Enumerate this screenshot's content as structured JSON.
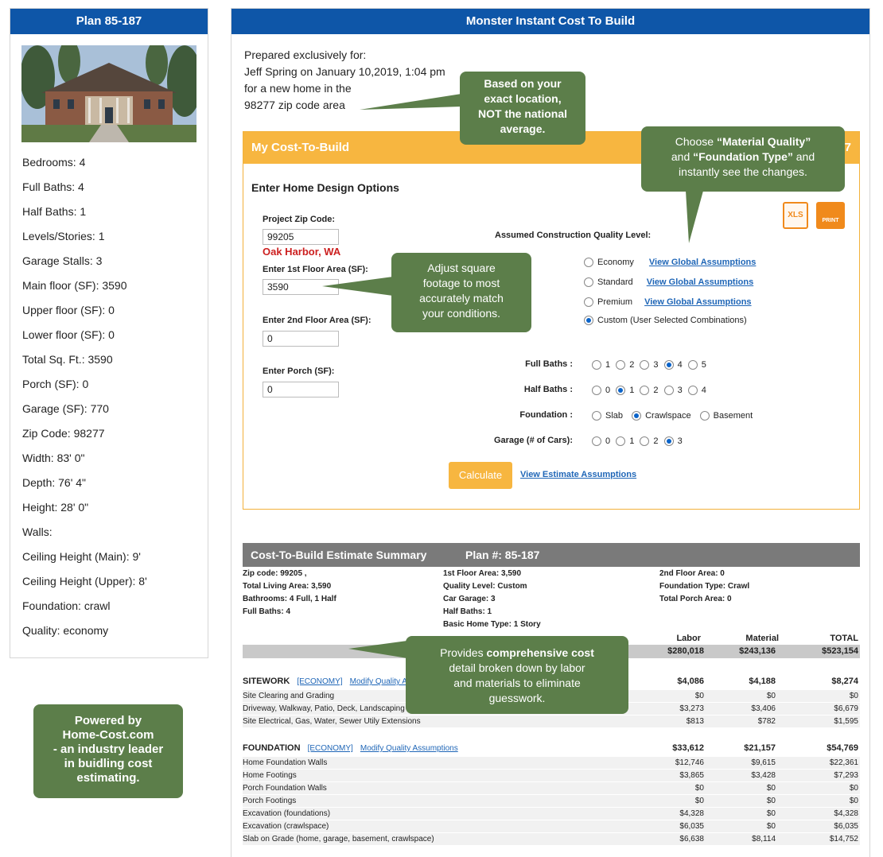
{
  "sidebar": {
    "title": "Plan 85-187",
    "specs": [
      "Bedrooms: 4",
      "Full Baths: 4",
      "Half Baths: 1",
      "Levels/Stories: 1",
      "Garage Stalls: 3",
      "Main floor (SF): 3590",
      "Upper floor (SF): 0",
      "Lower floor (SF): 0",
      "Total Sq. Ft.: 3590",
      "Porch (SF): 0",
      "Garage (SF): 770",
      "Zip Code: 98277",
      "Width: 83' 0\"",
      "Depth: 76' 4\"",
      "Height: 28' 0\"",
      "Walls:",
      "Ceiling Height (Main): 9'",
      "Ceiling Height (Upper): 8'",
      "Foundation: crawl",
      "Quality: economy"
    ]
  },
  "powered": [
    "Powered by",
    "Home-Cost.com",
    "- an industry leader",
    "in buidling cost",
    "estimating."
  ],
  "main": {
    "title": "Monster Instant Cost To Build",
    "prepared": [
      "Prepared exclusively for:",
      "Jeff Spring on January 10,2019, 1:04 pm",
      "for a new home in the",
      "98277 zip code area"
    ]
  },
  "callouts": {
    "location": [
      "Based on your",
      "exact location,",
      "NOT the national",
      "average."
    ],
    "material_pre": "Choose ",
    "material_b1": "“Material Quality”",
    "material_mid": "and ",
    "material_b2": "“Foundation Type”",
    "material_post": " and",
    "material_last": "instantly see the changes.",
    "sqft": [
      "Adjust square",
      "footage to most",
      "accurately match",
      "your conditions."
    ],
    "detail_pre": "Provides ",
    "detail_b": "comprehensive cost",
    "detail_rest": [
      "detail broken down by labor",
      "and materials to eliminate",
      "guesswork."
    ]
  },
  "mcb": {
    "title": "My Cost-To-Build",
    "plan_suffix": "187",
    "section_title": "Enter Home Design Options",
    "zip_label": "Project Zip Code:",
    "zip_value": "99205",
    "city": "Oak Harbor, WA",
    "floor1_label": "Enter 1st Floor Area (SF):",
    "floor1_value": "3590",
    "floor2_label": "Enter 2nd Floor Area (SF):",
    "floor2_value": "0",
    "porch_label": "Enter Porch (SF):",
    "porch_value": "0",
    "quality_label": "Assumed Construction Quality Level:",
    "quality_options": [
      {
        "label": "Economy",
        "link": "View Global Assumptions"
      },
      {
        "label": "Standard",
        "link": "View Global Assumptions"
      },
      {
        "label": "Premium",
        "link": "View Global Assumptions"
      },
      {
        "label": "Custom (User Selected Combinations)",
        "link": ""
      }
    ],
    "full_baths_label": "Full Baths :",
    "full_baths_opts": [
      "1",
      "2",
      "3",
      "4",
      "5"
    ],
    "half_baths_label": "Half Baths :",
    "half_baths_opts": [
      "0",
      "1",
      "2",
      "3",
      "4"
    ],
    "foundation_label": "Foundation :",
    "foundation_opts": [
      "Slab",
      "Crawlspace",
      "Basement"
    ],
    "garage_label": "Garage (# of Cars):",
    "garage_opts": [
      "0",
      "1",
      "2",
      "3"
    ],
    "calculate": "Calculate",
    "view_assumptions": "View Estimate Assumptions",
    "xls": "XLS",
    "print": "PRINT"
  },
  "summary": {
    "title": "Cost-To-Build Estimate Summary",
    "plan": "Plan #: 85-187",
    "col1": [
      "Zip code: 99205 ,",
      "Total Living Area: 3,590",
      "Bathrooms: 4 Full, 1 Half",
      "Full Baths: 4"
    ],
    "col2": [
      "1st Floor Area: 3,590",
      "Quality Level: Custom",
      "Car Garage: 3",
      "Half Baths: 1",
      "Basic Home Type: 1 Story"
    ],
    "col3": [
      "2nd Floor Area: 0",
      "Foundation Type: Crawl",
      "Total Porch Area: 0"
    ],
    "headers": [
      "Labor",
      "Material",
      "TOTAL"
    ],
    "totals": [
      "$280,018",
      "$243,136",
      "$523,154"
    ]
  },
  "sections": [
    {
      "name": "SITEWORK",
      "tag": "[ECONOMY]",
      "link": "Modify Quality Assu",
      "values": [
        "$4,086",
        "$4,188",
        "$8,274"
      ],
      "items": [
        {
          "label": "Site Clearing and Grading",
          "values": [
            "$0",
            "$0",
            "$0"
          ]
        },
        {
          "label": "Driveway, Walkway, Patio, Deck, Landscaping",
          "values": [
            "$3,273",
            "$3,406",
            "$6,679"
          ]
        },
        {
          "label": "Site Electrical, Gas, Water, Sewer Utily Extensions",
          "values": [
            "$813",
            "$782",
            "$1,595"
          ]
        }
      ]
    },
    {
      "name": "FOUNDATION",
      "tag": "[ECONOMY]",
      "link": "Modify Quality Assumptions",
      "values": [
        "$33,612",
        "$21,157",
        "$54,769"
      ],
      "items": [
        {
          "label": "Home Foundation Walls",
          "values": [
            "$12,746",
            "$9,615",
            "$22,361"
          ]
        },
        {
          "label": "Home Footings",
          "values": [
            "$3,865",
            "$3,428",
            "$7,293"
          ]
        },
        {
          "label": "Porch Foundation Walls",
          "values": [
            "$0",
            "$0",
            "$0"
          ]
        },
        {
          "label": "Porch Footings",
          "values": [
            "$0",
            "$0",
            "$0"
          ]
        },
        {
          "label": "Excavation (foundations)",
          "values": [
            "$4,328",
            "$0",
            "$4,328"
          ]
        },
        {
          "label": "Excavation (crawlspace)",
          "values": [
            "$6,035",
            "$0",
            "$6,035"
          ]
        },
        {
          "label": "Slab on Grade (home, garage, basement, crawlspace)",
          "values": [
            "$6,638",
            "$8,114",
            "$14,752"
          ]
        }
      ]
    }
  ],
  "colors": {
    "header_blue": "#0e56a8",
    "callout_green": "#5c7e4a",
    "accent_orange": "#f7b640",
    "summary_gray": "#7a7a7a",
    "city_red": "#cc1f1f"
  }
}
